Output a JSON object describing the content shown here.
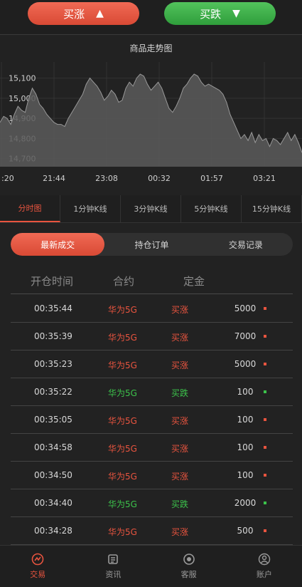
{
  "actions": {
    "rise_label": "买涨",
    "rise_icon": "▲",
    "fall_label": "买跌",
    "fall_icon": "▼"
  },
  "chart": {
    "title": "商品走势图"
  },
  "chart_data": {
    "type": "area",
    "title": "商品走势图",
    "x_ticks": [
      ":20",
      "21:44",
      "23:08",
      "00:32",
      "01:57",
      "03:21"
    ],
    "y_ticks": [
      15100,
      15000,
      14900,
      14800,
      14700
    ],
    "y_tick_labels": [
      "15,100",
      "15,000",
      "14,900",
      "14,800",
      "14,700"
    ],
    "ylim": [
      14660,
      15180
    ],
    "grid": true,
    "series": [
      {
        "values": [
          14880,
          14910,
          14900,
          14870,
          14920,
          14960,
          14940,
          14930,
          15000,
          15050,
          15020,
          14970,
          14950,
          14920,
          14900,
          14880,
          14870,
          14870,
          14860,
          14900,
          14930,
          14960,
          14990,
          15020,
          15070,
          15100,
          15080,
          15060,
          15030,
          14990,
          15010,
          15040,
          15020,
          14980,
          14990,
          15050,
          15080,
          15060,
          15100,
          15120,
          15110,
          15070,
          15040,
          15060,
          15080,
          15050,
          15000,
          14950,
          14930,
          14960,
          15000,
          15050,
          15070,
          15100,
          15120,
          15110,
          15080,
          15060,
          15070,
          15060,
          15050,
          15040,
          15020,
          14980,
          14920,
          14880,
          14840,
          14800,
          14820,
          14790,
          14830,
          14780,
          14820,
          14790,
          14800,
          14760,
          14800,
          14790,
          14770,
          14800,
          14830,
          14790,
          14820,
          14780,
          14730
        ]
      }
    ]
  },
  "period_tabs": [
    "分时图",
    "1分钟K线",
    "3分钟K线",
    "5分钟K线",
    "15分钟K线"
  ],
  "segments": [
    "最新成交",
    "持仓订单",
    "交易记录"
  ],
  "table": {
    "headers": [
      "开仓时间",
      "合约",
      "定金"
    ],
    "rows": [
      {
        "time": "00:35:44",
        "contract": "华为5G",
        "direction": "买涨",
        "amount": "5000",
        "side": "rise"
      },
      {
        "time": "00:35:39",
        "contract": "华为5G",
        "direction": "买涨",
        "amount": "7000",
        "side": "rise"
      },
      {
        "time": "00:35:23",
        "contract": "华为5G",
        "direction": "买涨",
        "amount": "5000",
        "side": "rise"
      },
      {
        "time": "00:35:22",
        "contract": "华为5G",
        "direction": "买跌",
        "amount": "100",
        "side": "fall"
      },
      {
        "time": "00:35:05",
        "contract": "华为5G",
        "direction": "买涨",
        "amount": "100",
        "side": "rise"
      },
      {
        "time": "00:34:58",
        "contract": "华为5G",
        "direction": "买涨",
        "amount": "100",
        "side": "rise"
      },
      {
        "time": "00:34:50",
        "contract": "华为5G",
        "direction": "买涨",
        "amount": "100",
        "side": "rise"
      },
      {
        "time": "00:34:40",
        "contract": "华为5G",
        "direction": "买跌",
        "amount": "2000",
        "side": "fall"
      },
      {
        "time": "00:34:28",
        "contract": "华为5G",
        "direction": "买涨",
        "amount": "500",
        "side": "rise"
      }
    ]
  },
  "nav": [
    {
      "label": "交易",
      "icon": "trade-icon"
    },
    {
      "label": "资讯",
      "icon": "news-icon"
    },
    {
      "label": "客服",
      "icon": "support-icon"
    },
    {
      "label": "账户",
      "icon": "account-icon"
    }
  ],
  "colors": {
    "rise": "#e8543f",
    "fall": "#3cc24b"
  }
}
